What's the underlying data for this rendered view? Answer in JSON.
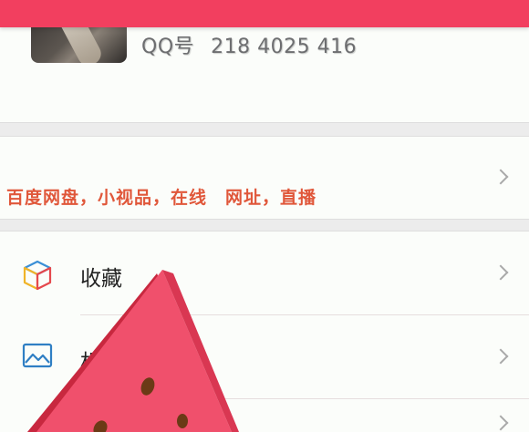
{
  "profile": {
    "qq_label": "QQ号",
    "qq_number": "218 4025 416"
  },
  "banner": {
    "text": "百度网盘，小视品，在线　网址，直播"
  },
  "menu": {
    "items": [
      {
        "label": "收藏",
        "icon": "cube-icon"
      },
      {
        "label": "相",
        "icon": "image-icon"
      }
    ]
  },
  "colors": {
    "accent": "#f23f5f",
    "banner_text": "#e0573a",
    "divider": "#ececec"
  }
}
